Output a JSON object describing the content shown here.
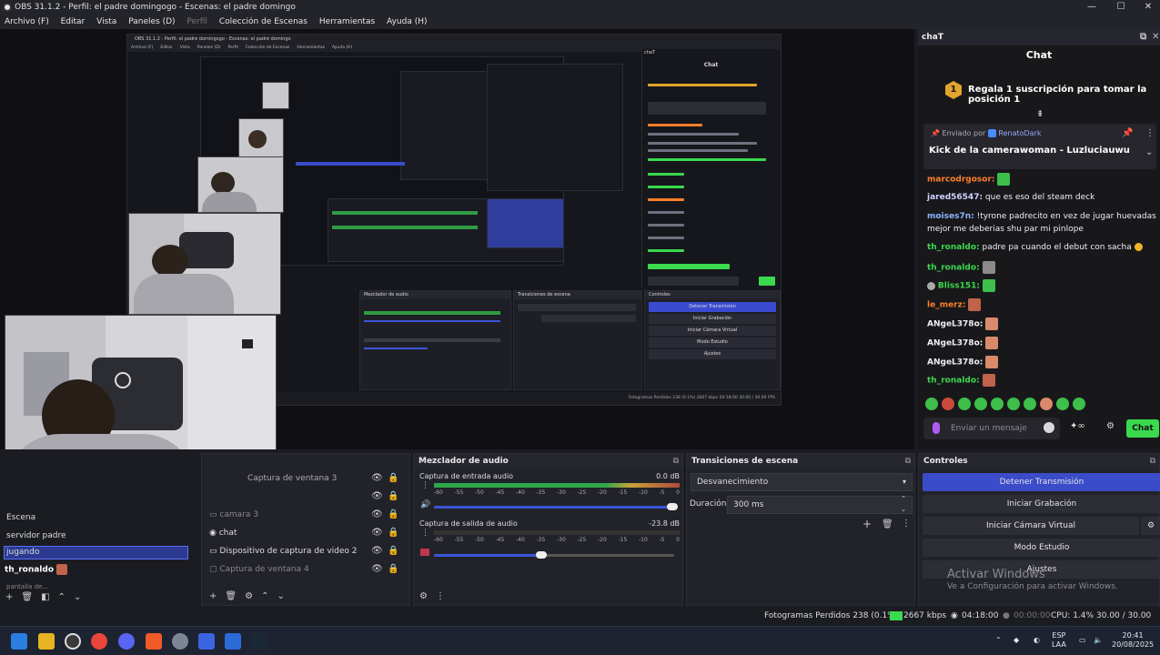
{
  "window": {
    "title": "OBS 31.1.2 - Perfil: el padre domingogo - Escenas: el padre domingo",
    "minimize": "—",
    "maximize": "☐",
    "close": "✕"
  },
  "menu": [
    "Archivo (F)",
    "Editar",
    "Vista",
    "Paneles (D)",
    "Perfil",
    "Colección de Escenas",
    "Herramientas",
    "Ayuda (H)"
  ],
  "nested": {
    "title": "OBS 31.1.2 - Perfil: el padre domingogo - Escenas: el padre domingo",
    "menu": [
      "Archivo (F)",
      "Editar",
      "Vista",
      "Paneles (D)",
      "Perfil",
      "Colección de Escenas",
      "Herramientas",
      "Ayuda (H)"
    ],
    "chat_dock": "chaT",
    "chat_title": "Chat",
    "mixer": "Mezclador de audio",
    "transitions": "Transiciones de escena",
    "controls": "Controles",
    "btns": [
      "Detener Transmisión",
      "Iniciar Grabación",
      "Iniciar Cámara Virtual",
      "Modo Estudio",
      "Ajustes"
    ],
    "status": "Fotogramas Perdidos 238 (0.1%)   2667 kbps   04:18:00   30.00 / 30.00 FPS"
  },
  "chat": {
    "dock_title": "chaT",
    "title": "Chat",
    "gift_number": "1",
    "gift_text": "Regala 1 suscripción para tomar la posición 1",
    "pinned_by_label": "Enviado por",
    "pinned_by": "RenatoDark",
    "pinned_msg": "Kick de la camerawoman - Luzluciauwu",
    "messages": [
      {
        "user": "marcodrgosor:",
        "text": "",
        "color": "#ff7f2a"
      },
      {
        "user": "jared56547:",
        "text": " que es eso del steam deck",
        "color": "#d0d0ff"
      },
      {
        "user": "moises7n:",
        "text": " !tyrone padrecito en vez de jugar huevadas",
        "color": "#8ab4ff"
      },
      {
        "user": "",
        "text": "mejor me deberias shu par mi pinlope",
        "color": "#efeff1"
      },
      {
        "user": "th_ronaldo:",
        "text": " padre pa cuando el debut con sacha",
        "color": "#3ad94e"
      },
      {
        "user": "th_ronaldo:",
        "text": "",
        "color": "#3ad94e"
      },
      {
        "user": "Bliss151:",
        "text": "",
        "color": "#3ad94e"
      },
      {
        "user": "le_merz:",
        "text": "",
        "color": "#ff7f2a"
      },
      {
        "user": "ANgeL378o:",
        "text": "",
        "color": "#efeff1"
      },
      {
        "user": "ANgeL378o:",
        "text": "",
        "color": "#efeff1"
      },
      {
        "user": "ANgeL378o:",
        "text": "",
        "color": "#efeff1"
      },
      {
        "user": "th_ronaldo:",
        "text": "",
        "color": "#3ad94e"
      }
    ],
    "input_placeholder": "Enviar un mensaje",
    "send": "Chat"
  },
  "scenes": {
    "title": "Escena",
    "items": [
      "servidor padre",
      "jugando",
      "th_ronaldo"
    ],
    "overlay_rest": "pantalla de..."
  },
  "sources": {
    "items": [
      "Captura de ventana 3",
      "camara 3",
      "chat",
      "Dispositivo de captura de video 2",
      "Captura de ventana 4"
    ]
  },
  "mixer": {
    "title": "Mezclador de audio",
    "ch1": {
      "name": "Captura de entrada audio",
      "db": "0.0 dB"
    },
    "ch2": {
      "name": "Captura de salida de audio",
      "db": "-23.8 dB"
    },
    "ticks": [
      "-60",
      "-55",
      "-50",
      "-45",
      "-40",
      "-35",
      "-30",
      "-25",
      "-20",
      "-15",
      "-10",
      "-5",
      "0"
    ]
  },
  "transitions": {
    "title": "Transiciones de escena",
    "selected": "Desvanecimiento",
    "duration_label": "Duración",
    "duration_value": "300 ms"
  },
  "controls": {
    "title": "Controles",
    "buttons": [
      "Detener Transmisión",
      "Iniciar Grabación",
      "Iniciar Cámara Virtual",
      "Modo Estudio",
      "Ajustes"
    ]
  },
  "watermark": {
    "line1": "Activar Windows",
    "line2": "Ve a Configuración para activar Windows."
  },
  "status": {
    "dropped": "Fotogramas Perdidos 238 (0.1%)",
    "kbps": "2667 kbps",
    "stream_time": "04:18:00",
    "rec_time": "00:00:00",
    "cpu": "CPU: 1.4%",
    "fps": "30.00 / 30.00 FPS"
  },
  "taskbar": {
    "lang1": "ESP",
    "lang2": "LAA",
    "time": "20:41",
    "date": "20/08/2025"
  }
}
